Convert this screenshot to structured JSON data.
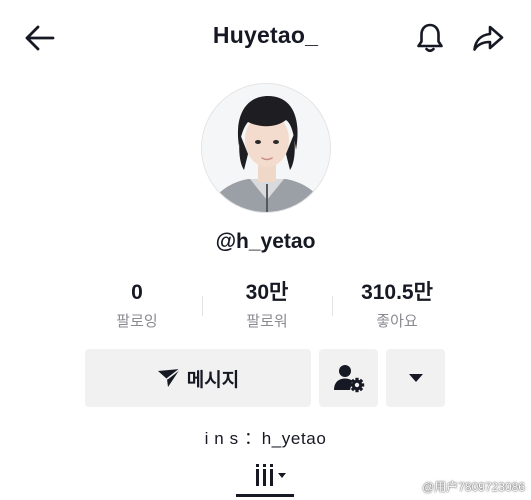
{
  "header": {
    "title": "Huyetao_",
    "back_icon": "arrow-left-icon",
    "bell_icon": "bell-icon",
    "share_icon": "share-icon"
  },
  "profile": {
    "username": "@h_yetao",
    "avatar": "avatar-photo"
  },
  "stats": [
    {
      "value": "0",
      "label": "팔로잉"
    },
    {
      "value": "30만",
      "label": "팔로워"
    },
    {
      "value": "310.5만",
      "label": "좋아요"
    }
  ],
  "actions": {
    "message_label": "메시지",
    "message_icon": "send-icon",
    "follow_settings_icon": "user-gear-icon",
    "dropdown_icon": "caret-down-icon"
  },
  "bio": "i n s ：h_yetao",
  "tabs": {
    "videos_icon": "grid-bars-icon"
  },
  "watermark": "@用户7809723086",
  "colors": {
    "text": "#161823",
    "secondary_text": "#8a8b91",
    "button_bg": "#f1f1f2"
  }
}
